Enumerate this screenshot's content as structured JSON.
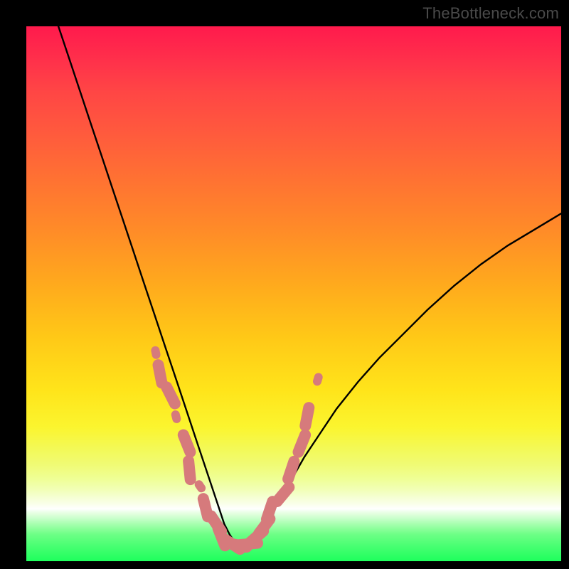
{
  "watermark": "TheBottleneck.com",
  "chart_data": {
    "type": "line",
    "title": "",
    "xlabel": "",
    "ylabel": "",
    "xlim": [
      0,
      100
    ],
    "ylim": [
      0,
      100
    ],
    "grid": false,
    "legend": false,
    "note": "V-shaped bottleneck curve on rainbow gradient background; curve minimum lies in the green band near x≈38. Salmon pill-shaped markers overlay the lower portion of the curve.",
    "series": [
      {
        "name": "bottleneck-curve",
        "color": "#000000",
        "x": [
          6,
          8,
          10,
          12,
          14,
          16,
          18,
          20,
          22,
          24,
          26,
          28,
          30,
          32,
          34,
          35,
          36,
          37,
          38,
          39,
          40,
          41,
          42,
          43,
          44,
          46,
          48,
          50,
          52,
          55,
          58,
          62,
          66,
          70,
          75,
          80,
          85,
          90,
          95,
          100
        ],
        "y": [
          100,
          94,
          88,
          82,
          76,
          70,
          64,
          58,
          52,
          46,
          40,
          34,
          28,
          22,
          16,
          13,
          10,
          7,
          5,
          3.5,
          3,
          3,
          3.5,
          4.5,
          6,
          9,
          12.5,
          16,
          19.5,
          24,
          28.5,
          33.5,
          38,
          42,
          47,
          51.5,
          55.5,
          59,
          62,
          65
        ]
      }
    ],
    "markers": {
      "color": "#d67a7c",
      "note": "rounded pill segments and small dots along the lower curve region",
      "points_x": [
        24.2,
        25.0,
        27.0,
        28.0,
        30.0,
        30.5,
        32.5,
        33.5,
        35.5,
        36.5,
        38.5,
        39.5,
        41.5,
        43.0,
        44.5,
        45.5,
        48.0,
        49.5,
        51.5,
        52.5,
        54.5
      ],
      "points_y": [
        39.0,
        35.0,
        31.0,
        27.0,
        22.0,
        17.0,
        14.0,
        10.0,
        7.0,
        4.5,
        3.2,
        3.0,
        3.2,
        4.5,
        6.5,
        9.5,
        12.5,
        17.0,
        22.0,
        27.0,
        34.0
      ]
    }
  }
}
